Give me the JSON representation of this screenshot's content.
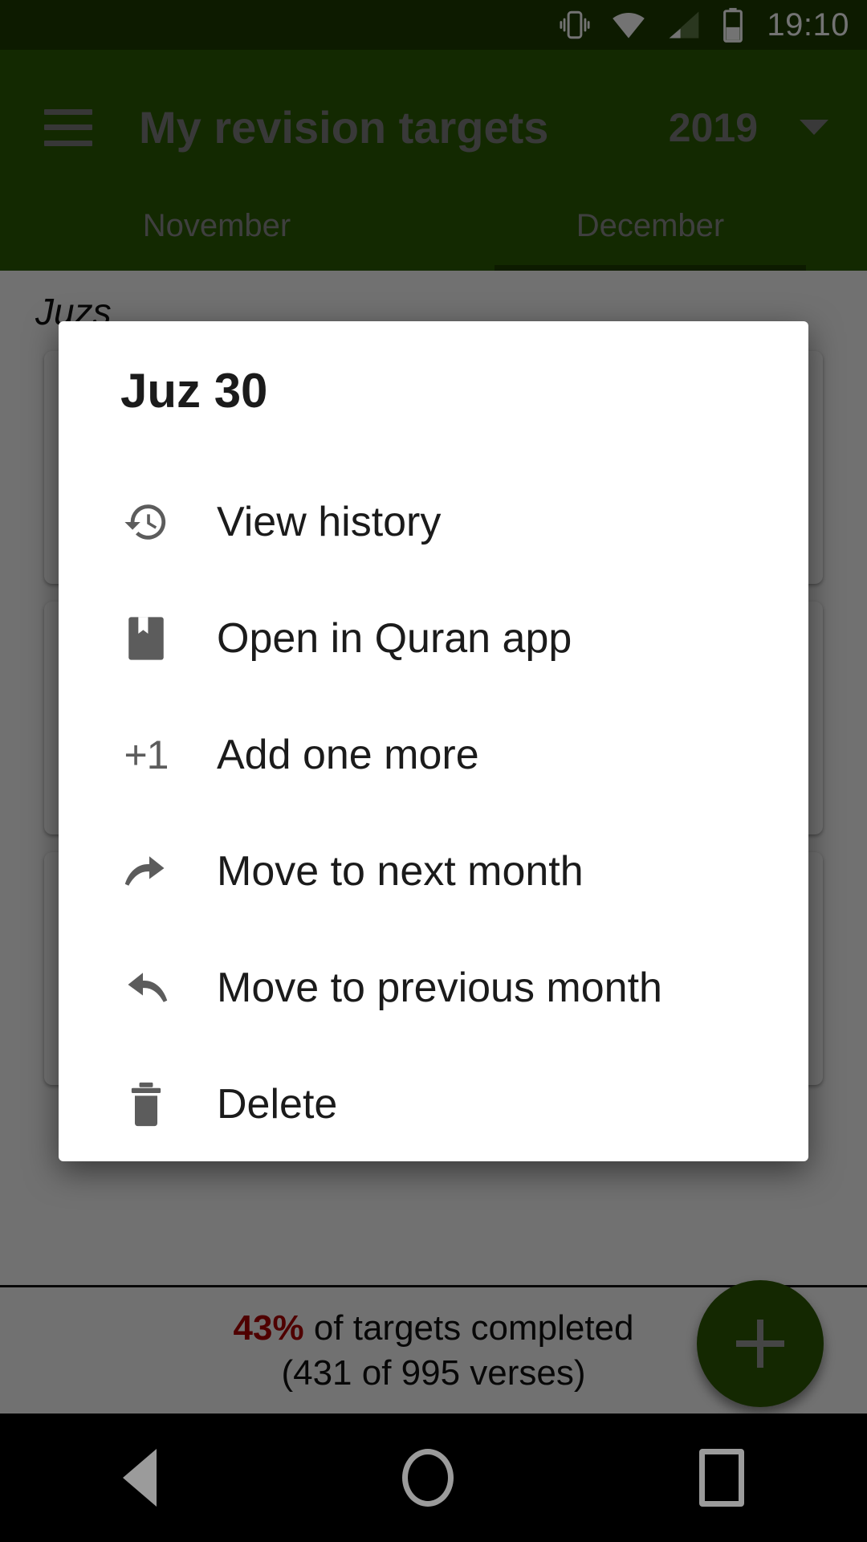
{
  "status_bar": {
    "time": "19:10",
    "icons": [
      "vibrate-icon",
      "wifi-icon",
      "cellular-signal-icon",
      "battery-icon"
    ],
    "background_color": "#1d3c02"
  },
  "app_bar": {
    "menu_icon": "hamburger-menu-icon",
    "title": "My revision targets",
    "year_value": "2019",
    "year_caret_icon": "chevron-down-icon",
    "background_color": "#2a5c03"
  },
  "tabs": [
    {
      "label": "November",
      "selected": false
    },
    {
      "label": "December",
      "selected": true
    }
  ],
  "content": {
    "heading": "Juzs"
  },
  "dialog": {
    "title": "Juz 30",
    "items": [
      {
        "label": "View history",
        "icon": "history-icon"
      },
      {
        "label": "Open in Quran app",
        "icon": "bookmark-book-icon"
      },
      {
        "label": "Add one more",
        "icon": "plus-one-icon",
        "icon_text": "+1"
      },
      {
        "label": "Move to next month",
        "icon": "redo-arrow-icon"
      },
      {
        "label": "Move to previous month",
        "icon": "undo-arrow-icon"
      },
      {
        "label": "Delete",
        "icon": "trash-icon"
      }
    ]
  },
  "bottom_summary": {
    "percent": "43%",
    "percent_color": "#b00000",
    "completed_text": " of targets completed",
    "verses_text": "(431 of 995 verses)"
  },
  "fab": {
    "icon": "plus-icon",
    "color": "#2e5a03"
  },
  "nav_bar": {
    "back_icon": "back-triangle-icon",
    "home_icon": "home-circle-icon",
    "recents_icon": "recents-square-icon"
  }
}
